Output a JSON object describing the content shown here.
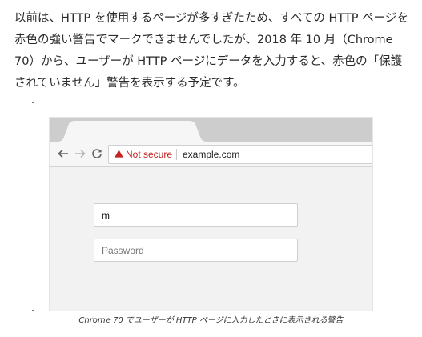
{
  "article": {
    "paragraph": "以前は、HTTP を使用するページが多すぎたため、すべての HTTP ページを赤色の強い警告でマークできませんでしたが、2018 年 10 月（Chrome 70）から、ユーザーが HTTP ページにデータを入力すると、赤色の「保護されていません」警告を表示する予定です。",
    "caption": "Chrome 70 でユーザーが HTTP ページに入力したときに表示される警告"
  },
  "browser": {
    "security_label": "Not secure",
    "url": "example.com",
    "warning_color": "#c5221f",
    "icons": {
      "back": "back-arrow-icon",
      "forward": "forward-arrow-icon",
      "reload": "reload-icon",
      "warning": "warning-triangle-icon"
    }
  },
  "form": {
    "username_value": "m",
    "password_placeholder": "Password"
  }
}
